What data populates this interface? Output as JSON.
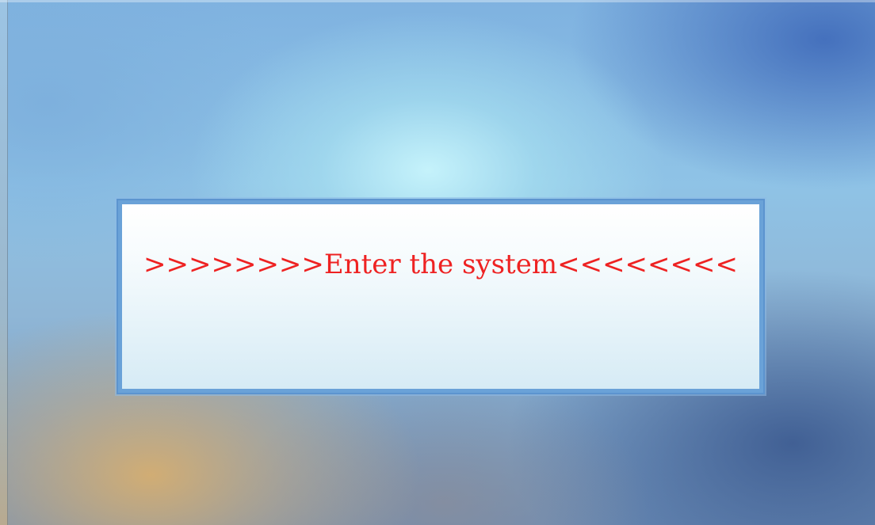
{
  "dialog": {
    "message": ">>>>>>>>Enter the system<<<<<<<<"
  },
  "colors": {
    "message_text": "#ee2222",
    "panel_border": "#5c94cf",
    "panel_background": "#e6f3f9"
  }
}
